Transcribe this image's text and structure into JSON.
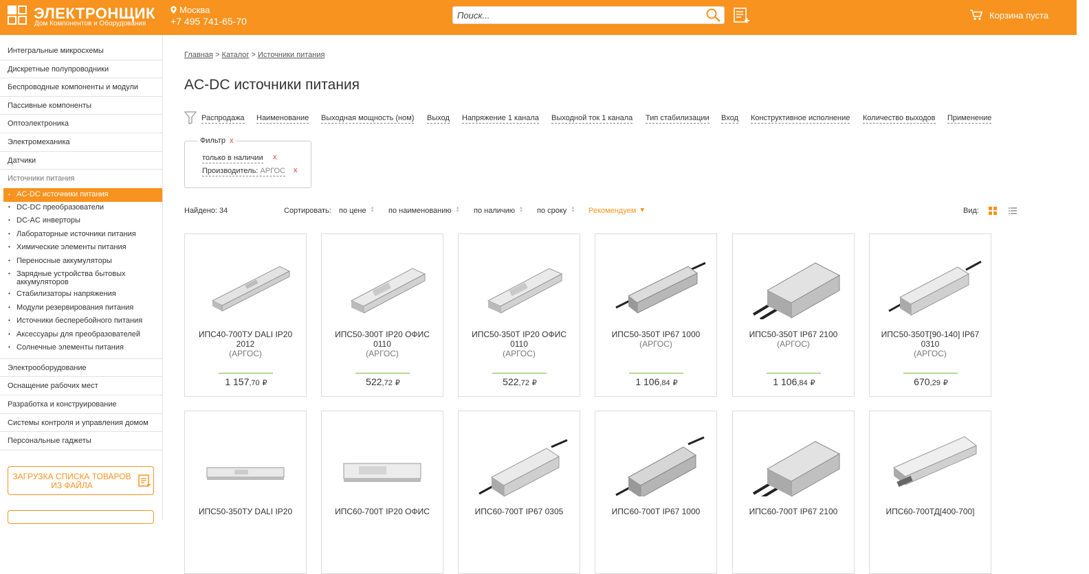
{
  "header": {
    "logo_title": "ЭЛЕКТРОНЩИК",
    "logo_subtitle": "Дом Компонентов и Оборудования",
    "city": "Москва",
    "phone": "+7 495 741-65-70",
    "search_placeholder": "Поиск...",
    "cart_label": "Корзина пуста"
  },
  "sidebar": {
    "categories_top": [
      "Интегральные микросхемы",
      "Дискретные полупроводники",
      "Беспроводные компоненты и модули",
      "Пассивные компоненты",
      "Оптоэлектроника",
      "Электромеханика",
      "Датчики"
    ],
    "open_category": "Источники питания",
    "subcategories": [
      "AC-DC источники питания",
      "DC-DC преобразователи",
      "DC-AC инверторы",
      "Лабораторные источники питания",
      "Химические элементы питания",
      "Переносные аккумуляторы",
      "Зарядные устройства бытовых аккумуляторов",
      "Стабилизаторы напряжения",
      "Модули резервирования питания",
      "Источники бесперебойного питания",
      "Аксессуары для преобразователей",
      "Солнечные элементы питания"
    ],
    "categories_bottom": [
      "Электрооборудование",
      "Оснащение рабочих мест",
      "Разработка и конструирование",
      "Системы контроля и управления домом",
      "Персональные гаджеты"
    ],
    "upload_button": "ЗАГРУЗКА СПИСКА ТОВАРОВ ИЗ ФАЙЛА"
  },
  "main": {
    "breadcrumb": [
      "Главная",
      "Каталог",
      "Источники питания"
    ],
    "breadcrumb_sep": ">",
    "title": "AC-DC источники питания",
    "filters": [
      "Распродажа",
      "Наименование",
      "Выходная мощность (ном)",
      "Выход",
      "Напряжение 1 канала",
      "Выходной ток 1 канала",
      "Тип стабилизации",
      "Вход",
      "Конструктивное исполнение",
      "Количество выходов",
      "Применение"
    ],
    "filter_box": {
      "title": "Фильтр",
      "remove": "x",
      "items": [
        {
          "label": "только в наличии",
          "value": ""
        },
        {
          "label": "Производитель:",
          "value": "АРГОС"
        }
      ]
    },
    "found": "Найдено: 34",
    "sort": {
      "label": "Сортировать:",
      "options": [
        "по цене",
        "по наименованию",
        "по наличию",
        "по сроку",
        "Рекомендуем"
      ]
    },
    "view_label": "Вид:"
  },
  "products": [
    {
      "name": "ИПС40-700ТУ DALI IP20 2012",
      "maker": "(АРГОС)",
      "price": "1 157",
      "kop": ",70",
      "cur": "₽"
    },
    {
      "name": "ИПС50-300Т IP20 ОФИС 0110",
      "maker": "(АРГОС)",
      "price": "522",
      "kop": ",72",
      "cur": "₽"
    },
    {
      "name": "ИПС50-350Т IP20 ОФИС 0110",
      "maker": "(АРГОС)",
      "price": "522",
      "kop": ",72",
      "cur": "₽"
    },
    {
      "name": "ИПС50-350Т IP67 1000",
      "maker": "(АРГОС)",
      "price": "1 106",
      "kop": ",84",
      "cur": "₽"
    },
    {
      "name": "ИПС50-350Т IP67 2100",
      "maker": "(АРГОС)",
      "price": "1 106",
      "kop": ",84",
      "cur": "₽"
    },
    {
      "name": "ИПС50-350Т[90-140] IP67 0310",
      "maker": "(АРГОС)",
      "price": "670",
      "kop": ",29",
      "cur": "₽"
    },
    {
      "name": "ИПС50-350ТУ DALI IP20",
      "maker": "",
      "price": "",
      "kop": "",
      "cur": ""
    },
    {
      "name": "ИПС60-700Т IP20 ОФИС",
      "maker": "",
      "price": "",
      "kop": "",
      "cur": ""
    },
    {
      "name": "ИПС60-700Т IP67 0305",
      "maker": "",
      "price": "",
      "kop": "",
      "cur": ""
    },
    {
      "name": "ИПС60-700Т IP67 1000",
      "maker": "",
      "price": "",
      "kop": "",
      "cur": ""
    },
    {
      "name": "ИПС60-700Т IP67 2100",
      "maker": "",
      "price": "",
      "kop": "",
      "cur": ""
    },
    {
      "name": "ИПС60-700ТД[400-700]",
      "maker": "",
      "price": "",
      "kop": "",
      "cur": ""
    }
  ],
  "colors": {
    "accent": "#f7931e",
    "price_line": "#7cb342",
    "remove": "#e53935"
  }
}
